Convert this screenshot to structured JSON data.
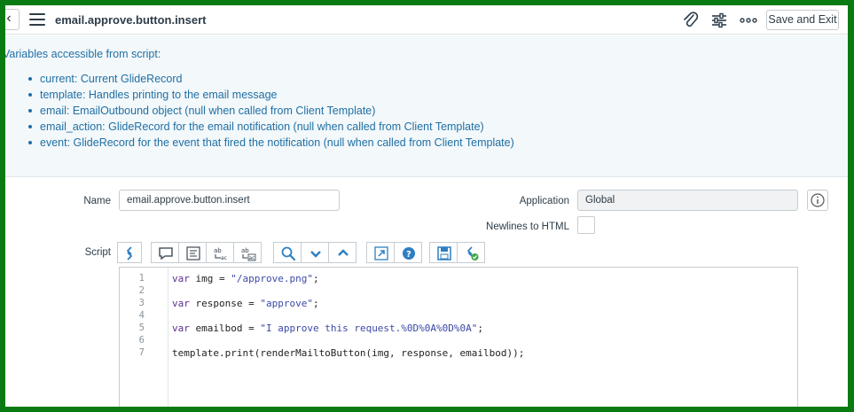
{
  "header": {
    "back_glyph": "‹",
    "title": "email.approve.button.insert",
    "save_exit_label": "Save and Exit"
  },
  "info": {
    "intro": "Variables accessible from script:",
    "items": [
      "current: Current GlideRecord",
      "template: Handles printing to the email message",
      "email: EmailOutbound object (null when called from Client Template)",
      "email_action: GlideRecord for the email notification (null when called from Client Template)",
      "event: GlideRecord for the event that fired the notification (null when called from Client Template)"
    ]
  },
  "form": {
    "name_label": "Name",
    "name_value": "email.approve.button.insert",
    "application_label": "Application",
    "application_value": "Global",
    "newlines_label": "Newlines to HTML",
    "script_label": "Script"
  },
  "editor": {
    "line_numbers": [
      "1",
      "2",
      "3",
      "4",
      "5",
      "6",
      "7"
    ],
    "lines": [
      {
        "kw": "var",
        "rest": " img = ",
        "str": "\"/approve.png\"",
        "end": ";"
      },
      {
        "kw": "",
        "rest": "",
        "str": "",
        "end": ""
      },
      {
        "kw": "var",
        "rest": " response = ",
        "str": "\"approve\"",
        "end": ";"
      },
      {
        "kw": "",
        "rest": "",
        "str": "",
        "end": ""
      },
      {
        "kw": "var",
        "rest": " emailbod = ",
        "str": "\"I approve this request.%0D%0A%0D%0A\"",
        "end": ";"
      },
      {
        "kw": "",
        "rest": "",
        "str": "",
        "end": ""
      },
      {
        "kw": "",
        "rest": "template.print(renderMailtoButton(img, response, emailbod));",
        "str": "",
        "end": ""
      }
    ]
  },
  "colors": {
    "border_green": "#0a7a12",
    "link_blue": "#1f6fa3",
    "icon_blue": "#2d7fc1"
  },
  "toolbar_icons": [
    "toggle-syntax-icon",
    "comment-icon",
    "format-icon",
    "replace-icon",
    "replace-all-icon",
    "search-icon",
    "fold-down-icon",
    "fold-up-icon",
    "fullscreen-icon",
    "help-icon",
    "save-icon",
    "script-debugger-icon"
  ]
}
